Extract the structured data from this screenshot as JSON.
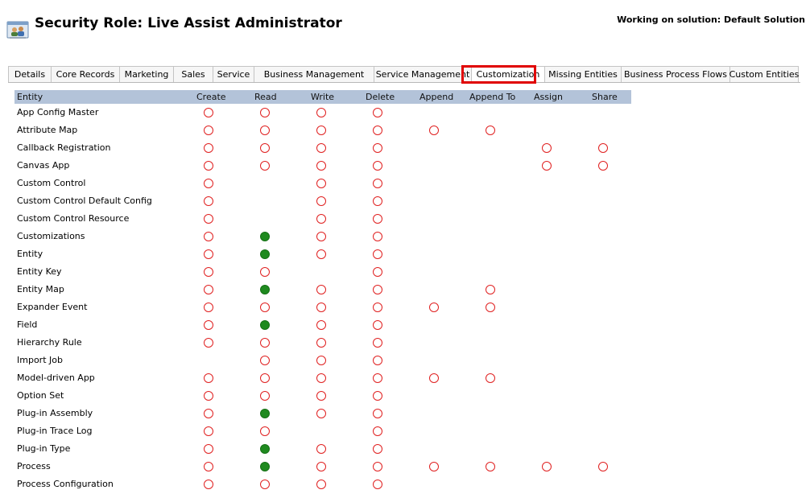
{
  "header": {
    "title": "Security Role: Live Assist Administrator",
    "solution": "Working on solution: Default Solution",
    "icon": "security-role-icon"
  },
  "tabs": [
    {
      "label": "Details"
    },
    {
      "label": "Core Records"
    },
    {
      "label": "Marketing"
    },
    {
      "label": "Sales"
    },
    {
      "label": "Service"
    },
    {
      "label": "Business Management"
    },
    {
      "label": "Service Management"
    },
    {
      "label": "Customization",
      "active": true
    },
    {
      "label": "Missing Entities"
    },
    {
      "label": "Business Process Flows"
    },
    {
      "label": "Custom Entities"
    }
  ],
  "grid": {
    "columns": [
      "Entity",
      "Create",
      "Read",
      "Write",
      "Delete",
      "Append",
      "Append To",
      "Assign",
      "Share"
    ],
    "legend": {
      "o": "none-selected",
      "g": "organization"
    },
    "rows": [
      {
        "entity": "App Config Master",
        "privs": [
          "o",
          "o",
          "o",
          "o",
          "",
          "",
          "",
          ""
        ]
      },
      {
        "entity": "Attribute Map",
        "privs": [
          "o",
          "o",
          "o",
          "o",
          "o",
          "o",
          "",
          ""
        ]
      },
      {
        "entity": "Callback Registration",
        "privs": [
          "o",
          "o",
          "o",
          "o",
          "",
          "",
          "o",
          "o"
        ]
      },
      {
        "entity": "Canvas App",
        "privs": [
          "o",
          "o",
          "o",
          "o",
          "",
          "",
          "o",
          "o"
        ]
      },
      {
        "entity": "Custom Control",
        "privs": [
          "o",
          "",
          "o",
          "o",
          "",
          "",
          "",
          ""
        ]
      },
      {
        "entity": "Custom Control Default Config",
        "privs": [
          "o",
          "",
          "o",
          "o",
          "",
          "",
          "",
          ""
        ]
      },
      {
        "entity": "Custom Control Resource",
        "privs": [
          "o",
          "",
          "o",
          "o",
          "",
          "",
          "",
          ""
        ]
      },
      {
        "entity": "Customizations",
        "privs": [
          "o",
          "g",
          "o",
          "o",
          "",
          "",
          "",
          ""
        ]
      },
      {
        "entity": "Entity",
        "privs": [
          "o",
          "g",
          "o",
          "o",
          "",
          "",
          "",
          ""
        ]
      },
      {
        "entity": "Entity Key",
        "privs": [
          "o",
          "o",
          "",
          "o",
          "",
          "",
          "",
          ""
        ]
      },
      {
        "entity": "Entity Map",
        "privs": [
          "o",
          "g",
          "o",
          "o",
          "",
          "o",
          "",
          ""
        ]
      },
      {
        "entity": "Expander Event",
        "privs": [
          "o",
          "o",
          "o",
          "o",
          "o",
          "o",
          "",
          ""
        ]
      },
      {
        "entity": "Field",
        "privs": [
          "o",
          "g",
          "o",
          "o",
          "",
          "",
          "",
          ""
        ]
      },
      {
        "entity": "Hierarchy Rule",
        "privs": [
          "o",
          "o",
          "o",
          "o",
          "",
          "",
          "",
          ""
        ]
      },
      {
        "entity": "Import Job",
        "privs": [
          "",
          "o",
          "o",
          "o",
          "",
          "",
          "",
          ""
        ]
      },
      {
        "entity": "Model-driven App",
        "privs": [
          "o",
          "o",
          "o",
          "o",
          "o",
          "o",
          "",
          ""
        ]
      },
      {
        "entity": "Option Set",
        "privs": [
          "o",
          "o",
          "o",
          "o",
          "",
          "",
          "",
          ""
        ]
      },
      {
        "entity": "Plug-in Assembly",
        "privs": [
          "o",
          "g",
          "o",
          "o",
          "",
          "",
          "",
          ""
        ]
      },
      {
        "entity": "Plug-in Trace Log",
        "privs": [
          "o",
          "o",
          "",
          "o",
          "",
          "",
          "",
          ""
        ]
      },
      {
        "entity": "Plug-in Type",
        "privs": [
          "o",
          "g",
          "o",
          "o",
          "",
          "",
          "",
          ""
        ]
      },
      {
        "entity": "Process",
        "privs": [
          "o",
          "g",
          "o",
          "o",
          "o",
          "o",
          "o",
          "o"
        ]
      },
      {
        "entity": "Process Configuration",
        "privs": [
          "o",
          "o",
          "o",
          "o",
          "",
          "",
          "",
          ""
        ]
      }
    ]
  }
}
